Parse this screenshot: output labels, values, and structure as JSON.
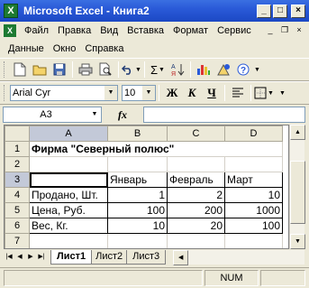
{
  "window": {
    "title": "Microsoft Excel - Книга2",
    "app_icon_letter": "X",
    "minimize": "_",
    "maximize": "□",
    "close": "×"
  },
  "menu": {
    "row1": [
      "Файл",
      "Правка",
      "Вид",
      "Вставка",
      "Формат",
      "Сервис"
    ],
    "row2": [
      "Данные",
      "Окно",
      "Справка"
    ]
  },
  "toolbar": {
    "font_name": "Arial Cyr",
    "font_size": "10",
    "sigma": "Σ",
    "bold_label": "Ж",
    "italic_label": "К",
    "underline_label": "Ч"
  },
  "formula": {
    "name_box": "A3",
    "fx_label": "fx",
    "value": ""
  },
  "sheet": {
    "columns": [
      "A",
      "B",
      "C",
      "D"
    ],
    "rows": [
      {
        "num": "1",
        "cells": [
          "Фирма \"Северный полюс\"",
          "",
          "",
          ""
        ]
      },
      {
        "num": "2",
        "cells": [
          "",
          "",
          "",
          ""
        ]
      },
      {
        "num": "3",
        "cells": [
          "",
          "Январь",
          "Февраль",
          "Март"
        ]
      },
      {
        "num": "4",
        "cells": [
          "Продано, Шт.",
          "1",
          "2",
          "10"
        ]
      },
      {
        "num": "5",
        "cells": [
          "Цена, Руб.",
          "100",
          "200",
          "1000"
        ]
      },
      {
        "num": "6",
        "cells": [
          "Вес, Кг.",
          "10",
          "20",
          "100"
        ]
      },
      {
        "num": "7",
        "cells": [
          "",
          "",
          "",
          ""
        ]
      }
    ],
    "active_cell": "A3",
    "tabs": [
      "Лист1",
      "Лист2",
      "Лист3"
    ],
    "active_tab": "Лист1"
  },
  "status": {
    "num": "NUM"
  },
  "colors": {
    "titlebar": "#2a5ad8",
    "chrome": "#ece9d8",
    "header_selected": "#c3c9d8"
  }
}
